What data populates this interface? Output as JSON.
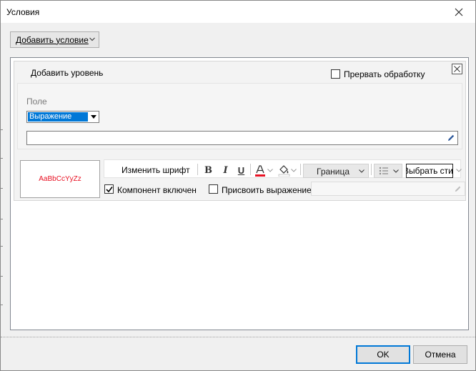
{
  "window": {
    "title": "Условия"
  },
  "toolbar": {
    "add_condition_label": "Добавить условие"
  },
  "level": {
    "add_level_label": "Добавить уровень",
    "interrupt_label": "Прервать обработку",
    "interrupt_checked": false
  },
  "field": {
    "label": "Поле",
    "selected": "Выражение",
    "expression_value": ""
  },
  "style": {
    "preview_text": "AaBbCcYyZz",
    "preview_color": "#e81123",
    "change_font_label": "Изменить шрифт",
    "bold_label": "B",
    "italic_label": "I",
    "underline_label": "U",
    "font_color_glyph": "A",
    "font_color": "#e81123",
    "border_label": "Граница",
    "style_select_value": "Выбрать стиль",
    "component_enabled_label": "Компонент включен",
    "component_enabled_checked": true,
    "assign_expression_label": "Присвоить выражение",
    "assign_expression_checked": false
  },
  "buttons": {
    "ok_label": "OK",
    "cancel_label": "Отмена"
  },
  "colors": {
    "accent": "#0078d7"
  }
}
